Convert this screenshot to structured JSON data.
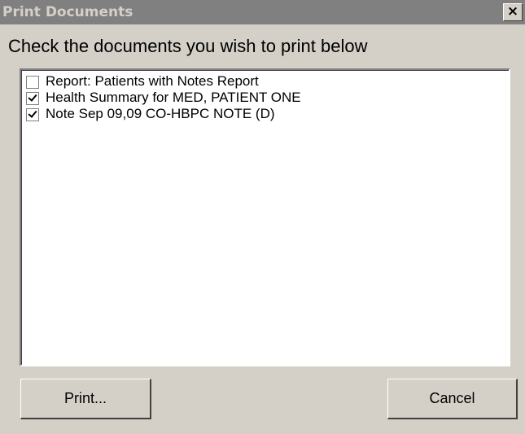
{
  "window": {
    "title": "Print Documents",
    "close_glyph": "×"
  },
  "instruction": "Check the documents you wish to print below",
  "documents": [
    {
      "label": "Report: Patients with Notes Report",
      "checked": false
    },
    {
      "label": "Health Summary for MED, PATIENT ONE",
      "checked": true
    },
    {
      "label": "Note Sep 09,09 CO-HBPC NOTE (D)",
      "checked": true
    }
  ],
  "buttons": {
    "print": "Print...",
    "cancel": "Cancel"
  },
  "icons": {
    "close": "close-icon",
    "checkbox": "checkbox-icon"
  }
}
